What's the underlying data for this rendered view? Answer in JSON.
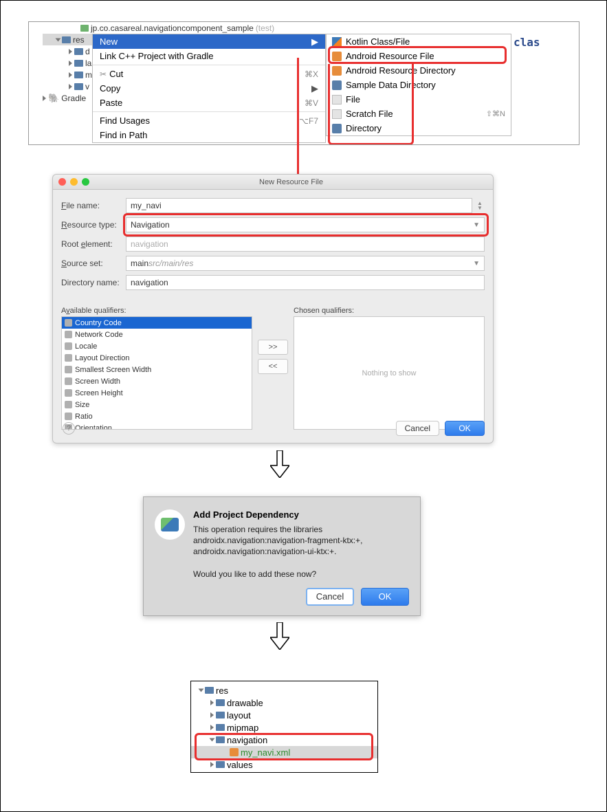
{
  "panel1": {
    "tree": {
      "test_pkg": "jp.co.casareal.navigationcomponent_sample",
      "test_tag": "(test)",
      "res": "res",
      "d": "d",
      "la": "la",
      "m": "m",
      "v": "v",
      "gradle": "Gradle"
    },
    "ctx": {
      "new": "New",
      "link": "Link C++ Project with Gradle",
      "cut": "Cut",
      "cut_sc": "⌘X",
      "copy": "Copy",
      "paste": "Paste",
      "paste_sc": "⌘V",
      "find_usages": "Find Usages",
      "find_usages_sc": "⌥F7",
      "find_in_path": "Find in Path"
    },
    "sub": {
      "kotlin": "Kotlin Class/File",
      "arf": "Android Resource File",
      "ard": "Android Resource Directory",
      "sdd": "Sample Data Directory",
      "file": "File",
      "scratch": "Scratch File",
      "scratch_sc": "⇧⌘N",
      "dir": "Directory"
    },
    "editor_keyword": "clas"
  },
  "dialog": {
    "title": "New Resource File",
    "file_name_label": "File name:",
    "file_name_value": "my_navi",
    "resource_type_label": "Resource type:",
    "resource_type_value": "Navigation",
    "root_element_label": "Root element:",
    "root_element_value": "navigation",
    "source_set_label": "Source set:",
    "source_set_main": "main ",
    "source_set_value": "src/main/res",
    "dir_name_label": "Directory name:",
    "dir_name_value": "navigation",
    "avail_label": "Available qualifiers:",
    "chosen_label": "Chosen qualifiers:",
    "chosen_empty": "Nothing to show",
    "qualifiers": [
      "Country Code",
      "Network Code",
      "Locale",
      "Layout Direction",
      "Smallest Screen Width",
      "Screen Width",
      "Screen Height",
      "Size",
      "Ratio",
      "Orientation"
    ],
    "btn_add": ">>",
    "btn_rem": "<<",
    "cancel": "Cancel",
    "ok": "OK"
  },
  "dep": {
    "title": "Add Project Dependency",
    "line1": "This operation requires the libraries",
    "line2": "androidx.navigation:navigation-fragment-ktx:+,",
    "line3": "androidx.navigation:navigation-ui-ktx:+.",
    "line4": "Would you like to add these now?",
    "cancel": "Cancel",
    "ok": "OK"
  },
  "result_tree": {
    "res": "res",
    "items": [
      "drawable",
      "layout",
      "mipmap",
      "navigation",
      "values"
    ],
    "navfile": "my_navi.xml"
  }
}
